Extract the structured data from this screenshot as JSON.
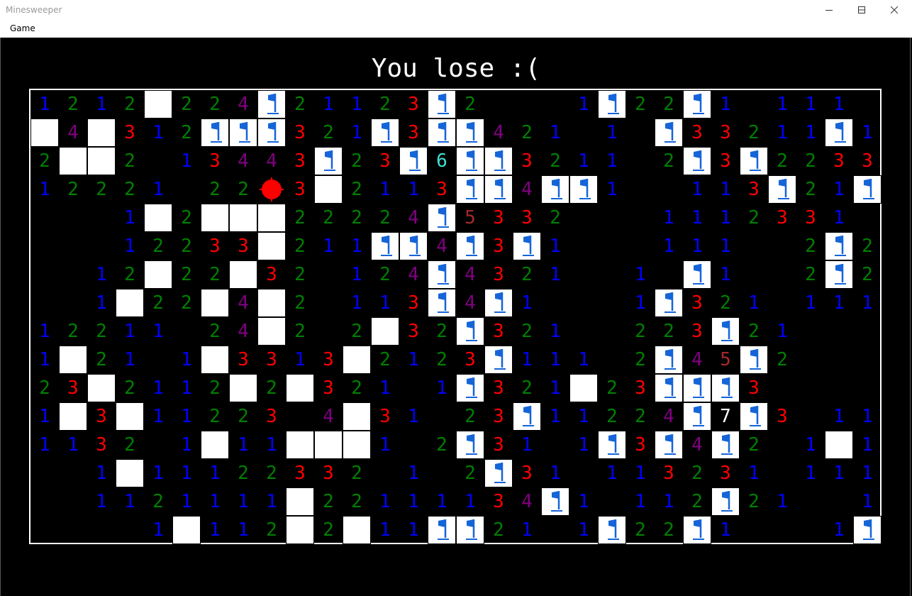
{
  "window": {
    "title": "Minesweeper"
  },
  "menu": {
    "game_label": "Game"
  },
  "status": {
    "message": "You lose :("
  },
  "board": {
    "cols": 30,
    "rows": 16,
    "legend": "H = covered, F = flag, M = exploded mine, . = empty, digit = neighbour count",
    "grid": [
      "1212H224F21123F2...1F22F1.111.",
      "H4H312FFF321F3FF421.1.F33211F1",
      "2HH2.13443F23F6FF3211.2F3F2233",
      "12221.22M3H2113FF4FF1..113F21F",
      "...1H2HHH22224F5332...1112331.",
      "...12233H211FF4F3F1...111..2F2",
      "..12H22H32.124F4321..1.F1..2F2",
      "..1H22H4H2.113F4F1...1F321.111",
      "12211.24H2.2H32F321..223F21...",
      "1H21.1H3313H2123F111.2F45F2...",
      "23H2112H2H321.1F321H23FFF3....",
      "1H3H11223.4H31.23F11224F7F3.11",
      "1132.1H11HHH1.2F31.1F3F4F2.1H1",
      "..1H11122332.1.2F31.113231.111",
      "..1121111H22111134F1.112F21..1",
      "....1H112H2H11FF21.1F22F1...1F"
    ],
    "number_colors": {
      "1": "#0000ff",
      "2": "#008000",
      "3": "#ff0000",
      "4": "#800080",
      "5": "#a52a2a",
      "6": "#40e0d0",
      "7": "#ffffff"
    },
    "flag_color": "#1565d8",
    "mine_color": "#ff0000",
    "covered_color": "#ffffff"
  }
}
